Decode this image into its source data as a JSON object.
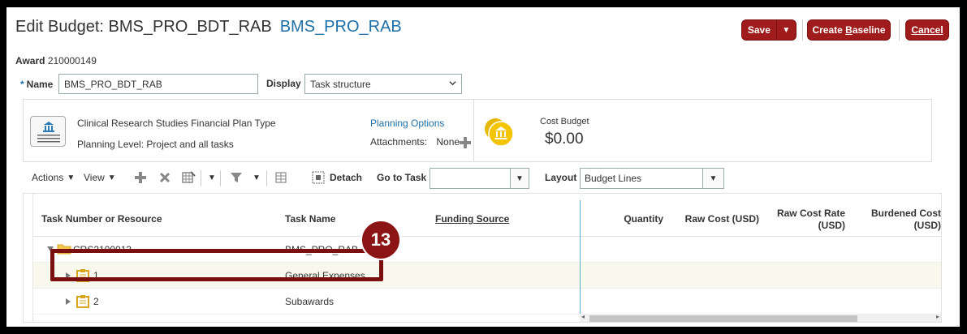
{
  "header": {
    "title": "Edit Budget: BMS_PRO_BDT_RAB",
    "subtitle": "BMS_PRO_RAB",
    "save_label": "Save",
    "create_baseline_label": "Create Baseline",
    "create_baseline_accel": "B",
    "cancel_label": "Cancel",
    "cancel_accel": "C"
  },
  "award": {
    "label": "Award",
    "value": "210000149"
  },
  "form": {
    "required_marker": "*",
    "name_label": "Name",
    "name_value": "BMS_PRO_BDT_RAB",
    "display_label": "Display",
    "display_value": "Task structure"
  },
  "plan": {
    "plan_type": "Clinical Research Studies Financial Plan Type",
    "planning_level": "Planning Level: Project and all tasks",
    "planning_options_link": "Planning Options",
    "attachments_label": "Attachments:",
    "attachments_value": "None",
    "cost_budget_label": "Cost Budget",
    "cost_budget_value": "$0.00"
  },
  "toolbar": {
    "actions_label": "Actions",
    "view_label": "View",
    "detach_label": "Detach",
    "go_to_task_label": "Go to Task",
    "layout_label": "Layout",
    "layout_value": "Budget Lines"
  },
  "table": {
    "columns": {
      "task_number": "Task Number or Resource",
      "task_name": "Task Name",
      "funding_source": "Funding Source",
      "quantity": "Quantity",
      "raw_cost": "Raw Cost (USD)",
      "raw_cost_rate_1": "Raw Cost Rate",
      "raw_cost_rate_2": "(USD)",
      "burdened_cost_1": "Burdened Cost",
      "burdened_cost_2": "(USD)"
    },
    "rows": [
      {
        "number": "CRS2100013",
        "name": "BMS_PRO_RAB"
      },
      {
        "number": "1",
        "name": "General Expenses"
      },
      {
        "number": "2",
        "name": "Subawards"
      }
    ]
  },
  "callout": {
    "step": "13"
  },
  "colors": {
    "brand_red": "#a01b1b",
    "link_blue": "#1f6fa8",
    "callout_red": "#7a0f0f"
  }
}
